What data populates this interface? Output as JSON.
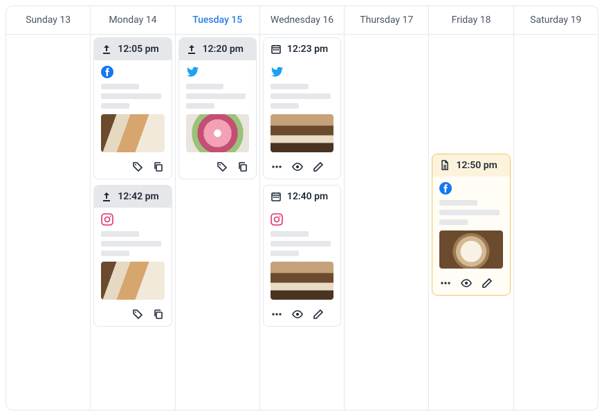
{
  "days": [
    {
      "label": "Sunday 13",
      "today": false
    },
    {
      "label": "Monday 14",
      "today": false
    },
    {
      "label": "Tuesday 15",
      "today": true
    },
    {
      "label": "Wednesday 16",
      "today": false
    },
    {
      "label": "Thursday 17",
      "today": false
    },
    {
      "label": "Friday 18",
      "today": false
    },
    {
      "label": "Saturday 19",
      "today": false
    }
  ],
  "posts": {
    "mon1": {
      "time": "12:05 pm",
      "status": "published",
      "platform": "facebook",
      "thumb": "burger",
      "actions": [
        "tag",
        "copy"
      ],
      "highlight": false
    },
    "mon2": {
      "time": "12:42 pm",
      "status": "published",
      "platform": "instagram",
      "thumb": "burger",
      "actions": [
        "tag",
        "copy"
      ],
      "highlight": false
    },
    "tue1": {
      "time": "12:20 pm",
      "status": "published",
      "platform": "twitter",
      "thumb": "flowers",
      "actions": [
        "tag",
        "copy"
      ],
      "highlight": false
    },
    "wed1": {
      "time": "12:23 pm",
      "status": "scheduled",
      "platform": "twitter",
      "thumb": "iced",
      "actions": [
        "more",
        "preview",
        "edit"
      ],
      "highlight": false
    },
    "wed2": {
      "time": "12:40 pm",
      "status": "scheduled",
      "platform": "instagram",
      "thumb": "iced",
      "actions": [
        "more",
        "preview",
        "edit"
      ],
      "highlight": false
    },
    "fri1": {
      "time": "12:50 pm",
      "status": "draft",
      "platform": "facebook",
      "thumb": "latte",
      "actions": [
        "more",
        "preview",
        "edit"
      ],
      "highlight": true
    }
  }
}
